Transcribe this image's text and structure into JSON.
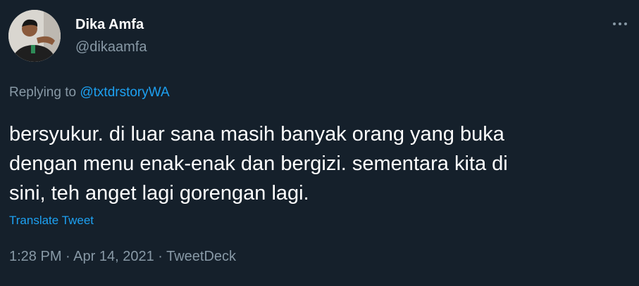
{
  "author": {
    "display_name": "Dika Amfa",
    "handle": "@dikaamfa"
  },
  "reply": {
    "prefix": "Replying to ",
    "mention": "@txtdrstoryWA"
  },
  "tweet": {
    "lines": [
      "bersyukur. di luar sana masih banyak orang yang buka",
      "dengan menu enak-enak dan bergizi. sementara kita di",
      "sini, teh anget lagi gorengan lagi."
    ]
  },
  "translate_label": "Translate Tweet",
  "meta": {
    "time": "1:28 PM",
    "separator": " · ",
    "date": "Apr 14, 2021",
    "source": "TweetDeck"
  },
  "icons": {
    "more": "more-horizontal-icon"
  },
  "colors": {
    "background": "#15202b",
    "primary_text": "#ffffff",
    "secondary_text": "#8899a6",
    "accent": "#1da1f2"
  }
}
